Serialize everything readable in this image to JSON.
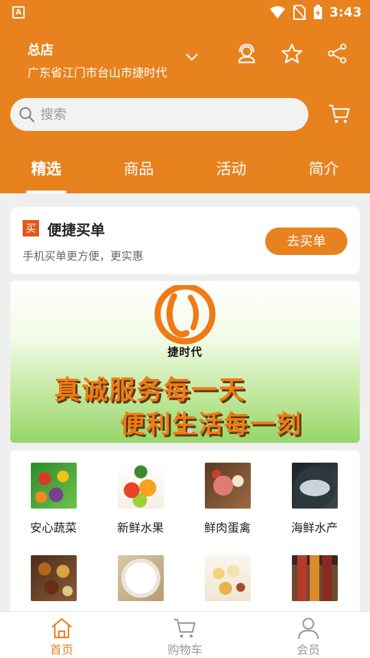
{
  "status_bar": {
    "app_letter": "A",
    "time": "3:43"
  },
  "header": {
    "store_name": "总店",
    "store_address": "广东省江门市台山市捷时代",
    "search_placeholder": "搜索",
    "tabs": [
      {
        "label": "精选",
        "active": true
      },
      {
        "label": "商品",
        "active": false
      },
      {
        "label": "活动",
        "active": false
      },
      {
        "label": "简介",
        "active": false
      }
    ]
  },
  "quick_buy": {
    "badge": "买",
    "title": "便捷买单",
    "subtitle": "手机买单更方便，更实惠",
    "button": "去买单"
  },
  "banner": {
    "logo_text": "捷时代",
    "line1": "真诚服务每一天",
    "line2": "便利生活每一刻",
    "slides": 2,
    "current_slide": 1
  },
  "categories": [
    {
      "label": "安心蔬菜",
      "icon": "vegetables-image"
    },
    {
      "label": "新鲜水果",
      "icon": "fruits-image"
    },
    {
      "label": "鲜肉蛋禽",
      "icon": "meat-eggs-image"
    },
    {
      "label": "海鲜水产",
      "icon": "seafood-image"
    },
    {
      "label": "",
      "icon": "spices-image"
    },
    {
      "label": "",
      "icon": "rice-image"
    },
    {
      "label": "",
      "icon": "dim-sum-image"
    },
    {
      "label": "",
      "icon": "preserved-jars-image"
    }
  ],
  "bottom_nav": [
    {
      "label": "首页",
      "icon": "home-icon",
      "active": true
    },
    {
      "label": "购物车",
      "icon": "cart-icon",
      "active": false
    },
    {
      "label": "会员",
      "icon": "user-icon",
      "active": false
    }
  ],
  "colors": {
    "brand": "#e8821e",
    "badge": "#e05a1b",
    "background": "#efefef"
  }
}
